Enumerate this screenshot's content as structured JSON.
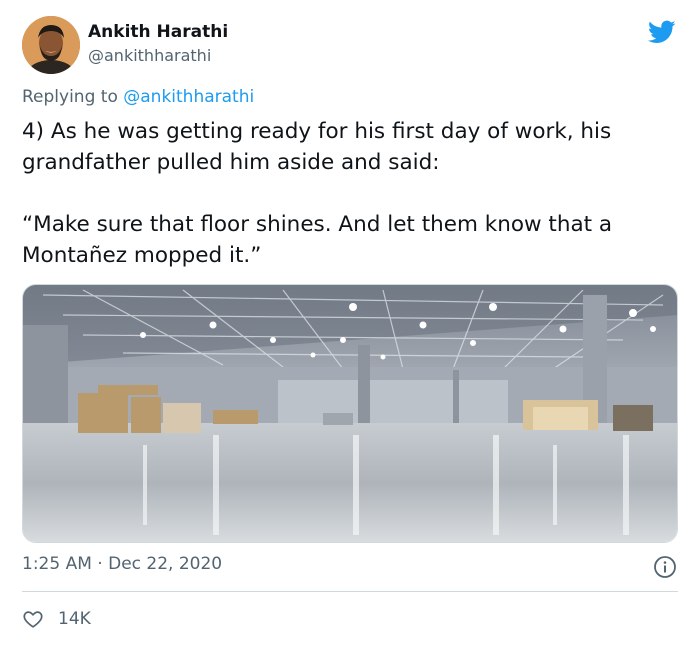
{
  "tweet": {
    "author_name": "Ankith Harathi",
    "author_handle": "@ankithharathi",
    "replying_prefix": "Replying to ",
    "replying_to": "@ankithharathi",
    "text_paragraph_1": "4) As he was getting ready for his first day of work, his grandfather pulled him aside and said:",
    "text_paragraph_2": "“Make sure that floor shines. And let them know that a Montañez mopped it.”",
    "time": "1:25 AM",
    "separator": "·",
    "date": "Dec 22, 2020",
    "like_count": "14K"
  },
  "icons": {
    "brand": "twitter-bird-icon",
    "info": "info-icon",
    "like": "heart-icon"
  },
  "colors": {
    "accent": "#1d9bf0",
    "secondary_text": "#536471",
    "primary_text": "#0f1419",
    "divider": "#cfd9de"
  }
}
